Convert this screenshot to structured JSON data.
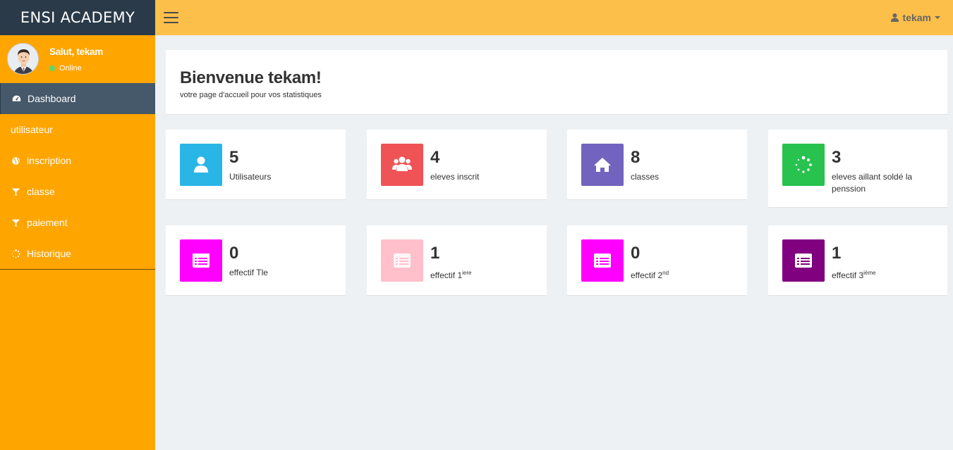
{
  "brand": "ENSI ACADEMY",
  "user_panel": {
    "greeting": "Salut, tekam",
    "status": "Online"
  },
  "menu": [
    {
      "label": "Dashboard",
      "icon": "dashboard-icon",
      "active": true
    },
    {
      "label": "utilisateur",
      "icon": "",
      "active": false
    },
    {
      "label": "inscription",
      "icon": "globe-icon",
      "active": false
    },
    {
      "label": "classe",
      "icon": "glass-icon",
      "active": false
    },
    {
      "label": "paiement",
      "icon": "glass-icon",
      "active": false
    },
    {
      "label": "Historique",
      "icon": "spinner-icon",
      "active": false
    }
  ],
  "topbar": {
    "user": "tekam"
  },
  "welcome": {
    "title": "Bienvenue tekam!",
    "subtitle": "votre page d'accueil pour vos statistiques"
  },
  "stats": [
    {
      "value": "5",
      "label": "Utilisateurs",
      "icon": "user-icon",
      "color": "#29b6e6"
    },
    {
      "value": "4",
      "label": "eleves inscrit",
      "icon": "users-icon",
      "color": "#ef5356"
    },
    {
      "value": "8",
      "label": "classes",
      "icon": "home-icon",
      "color": "#7264be"
    },
    {
      "value": "3",
      "label": "eleves aillant soldé la penssion",
      "icon": "spinner-icon",
      "color": "#28c24e"
    }
  ],
  "effectifs": [
    {
      "value": "0",
      "label": "effectif Tle",
      "sup": "",
      "icon": "list-icon",
      "color": "#ff00ff"
    },
    {
      "value": "1",
      "label": "effectif 1",
      "sup": "iere",
      "icon": "list-icon",
      "color": "#ffc0cb"
    },
    {
      "value": "0",
      "label": "effectif 2",
      "sup": "nd",
      "icon": "list-icon",
      "color": "#ff00ff"
    },
    {
      "value": "1",
      "label": "effectif 3",
      "sup": "iéme",
      "icon": "list-icon",
      "color": "#800080"
    }
  ]
}
